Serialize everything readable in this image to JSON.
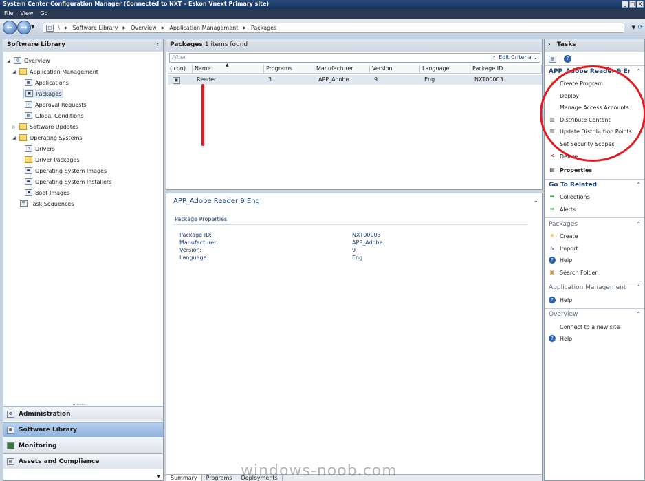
{
  "window": {
    "title": "System Center Configuration Manager (Connected to NXT – Eskon Vnext Primary site)"
  },
  "menu": [
    "File",
    "View",
    "Go"
  ],
  "breadcrumb": [
    "Software Library",
    "Overview",
    "Application Management",
    "Packages"
  ],
  "left": {
    "title": "Software Library",
    "tree": [
      {
        "label": "Overview",
        "icon": "overview-icon"
      },
      {
        "label": "Application Management",
        "icon": "folder-icon"
      },
      {
        "label": "Applications",
        "icon": "applications-icon"
      },
      {
        "label": "Packages",
        "icon": "packages-icon",
        "selected": true
      },
      {
        "label": "Approval Requests",
        "icon": "approval-icon"
      },
      {
        "label": "Global Conditions",
        "icon": "conditions-icon"
      },
      {
        "label": "Software Updates",
        "icon": "folder-icon"
      },
      {
        "label": "Operating Systems",
        "icon": "folder-icon"
      },
      {
        "label": "Drivers",
        "icon": "drivers-icon"
      },
      {
        "label": "Driver Packages",
        "icon": "driver-packages-icon"
      },
      {
        "label": "Operating System Images",
        "icon": "os-images-icon"
      },
      {
        "label": "Operating System Installers",
        "icon": "os-installers-icon"
      },
      {
        "label": "Boot Images",
        "icon": "boot-images-icon"
      },
      {
        "label": "Task Sequences",
        "icon": "task-sequences-icon"
      }
    ],
    "workspaces": [
      "Administration",
      "Software Library",
      "Monitoring",
      "Assets and Compliance"
    ]
  },
  "list": {
    "title": "Packages",
    "count_text": "1 items found",
    "filter_placeholder": "Filter",
    "edit_criteria": "Edit Criteria",
    "columns": [
      "(Icon)",
      "Name",
      "Programs",
      "Manufacturer",
      "Version",
      "Language",
      "Package ID"
    ],
    "rows": [
      {
        "name": "Reader",
        "programs": "3",
        "manufacturer": "APP_Adobe",
        "version": "9",
        "language": "Eng",
        "package_id": "NXT00003"
      }
    ]
  },
  "details": {
    "title": "APP_Adobe Reader 9 Eng",
    "section": "Package Properties",
    "props": [
      {
        "label": "Package ID:",
        "value": "NXT00003"
      },
      {
        "label": "Manufacturer:",
        "value": "APP_Adobe"
      },
      {
        "label": "Version:",
        "value": "9"
      },
      {
        "label": "Language:",
        "value": "Eng"
      }
    ],
    "tabs": [
      "Summary",
      "Programs",
      "Deployments"
    ]
  },
  "tasks": {
    "title": "Tasks",
    "selected_title": "APP_Adobe Reader 9 Eng",
    "actions": [
      "Create Program",
      "Deploy",
      "Manage Access Accounts",
      "Distribute Content",
      "Update Distribution Points",
      "Set Security Scopes",
      "Delete",
      "Properties"
    ],
    "goto_title": "Go To Related",
    "goto": [
      "Collections",
      "Alerts"
    ],
    "packages_title": "Packages",
    "packages": [
      "Create",
      "Import",
      "Help",
      "Search Folder"
    ],
    "appmgmt_title": "Application Management",
    "appmgmt": [
      "Help"
    ],
    "overview_title": "Overview",
    "overview": [
      "Connect to a new site",
      "Help"
    ]
  },
  "watermark": "windows-noob.com",
  "colors": {
    "annotation_red": "#e01b22",
    "heading_blue": "#1d3e6e"
  }
}
